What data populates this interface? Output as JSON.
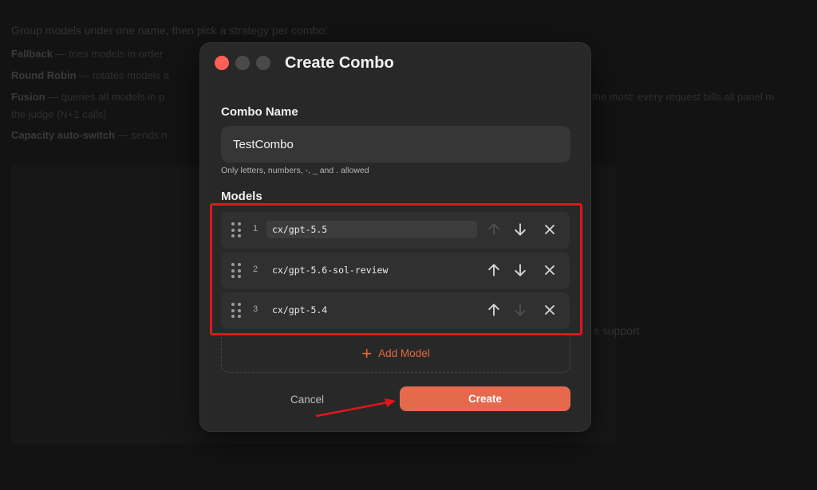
{
  "background": {
    "intro": "Group models under one name, then pick a strategy per combo:",
    "strategies": [
      {
        "name": "Fallback",
        "desc": " — tries models in order"
      },
      {
        "name": "Round Robin",
        "desc": " — rotates models a"
      },
      {
        "name": "Fusion",
        "desc": " — queries all models in p"
      },
      {
        "name": "",
        "desc": "the judge (N+1 calls)"
      },
      {
        "name": "Capacity auto-switch",
        "desc": " — sends n"
      }
    ],
    "fusion_tail": "the most: every request bills all panel m",
    "extra_text": "s support"
  },
  "modal": {
    "title": "Create Combo",
    "combo_name_label": "Combo Name",
    "combo_name_value": "TestCombo",
    "hint": "Only letters, numbers, -, _ and . allowed",
    "models_label": "Models",
    "models": [
      {
        "index": "1",
        "name": "cx/gpt-5.5"
      },
      {
        "index": "2",
        "name": "cx/gpt-5.6-sol-review"
      },
      {
        "index": "3",
        "name": "cx/gpt-5.4"
      }
    ],
    "add_model_label": "Add Model",
    "cancel_label": "Cancel",
    "create_label": "Create"
  },
  "colors": {
    "accent": "#e5694d",
    "highlight": "#e3151a",
    "close_dot": "#ff5f57"
  }
}
